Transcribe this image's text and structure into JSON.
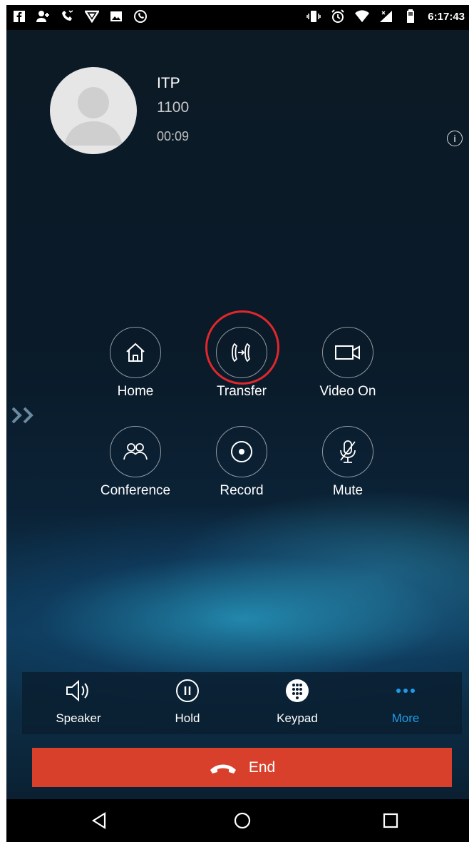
{
  "status_bar": {
    "time": "6:17:43",
    "left_icons": [
      "facebook-icon",
      "add-contact-icon",
      "call-icon",
      "vpn-icon",
      "image-icon",
      "whatsapp-icon"
    ],
    "right_icons": [
      "vibrate-icon",
      "alarm-icon",
      "wifi-icon",
      "signal-icon",
      "battery-icon"
    ]
  },
  "caller": {
    "name": "ITP",
    "number": "1100",
    "duration": "00:09"
  },
  "actions": [
    {
      "label": "Home",
      "icon": "home-icon"
    },
    {
      "label": "Transfer",
      "icon": "transfer-icon",
      "highlighted": true
    },
    {
      "label": "Video On",
      "icon": "video-icon"
    },
    {
      "label": "Conference",
      "icon": "conference-icon"
    },
    {
      "label": "Record",
      "icon": "record-icon"
    },
    {
      "label": "Mute",
      "icon": "mute-icon"
    }
  ],
  "bottom_bar": [
    {
      "label": "Speaker",
      "icon": "speaker-icon"
    },
    {
      "label": "Hold",
      "icon": "pause-icon"
    },
    {
      "label": "Keypad",
      "icon": "keypad-icon"
    },
    {
      "label": "More",
      "icon": "more-icon",
      "active": true
    }
  ],
  "end_button": {
    "label": "End"
  },
  "colors": {
    "accent": "#1e9be8",
    "end": "#d9402b",
    "highlight": "#e0272b"
  },
  "nav": [
    "back",
    "home",
    "recents"
  ]
}
